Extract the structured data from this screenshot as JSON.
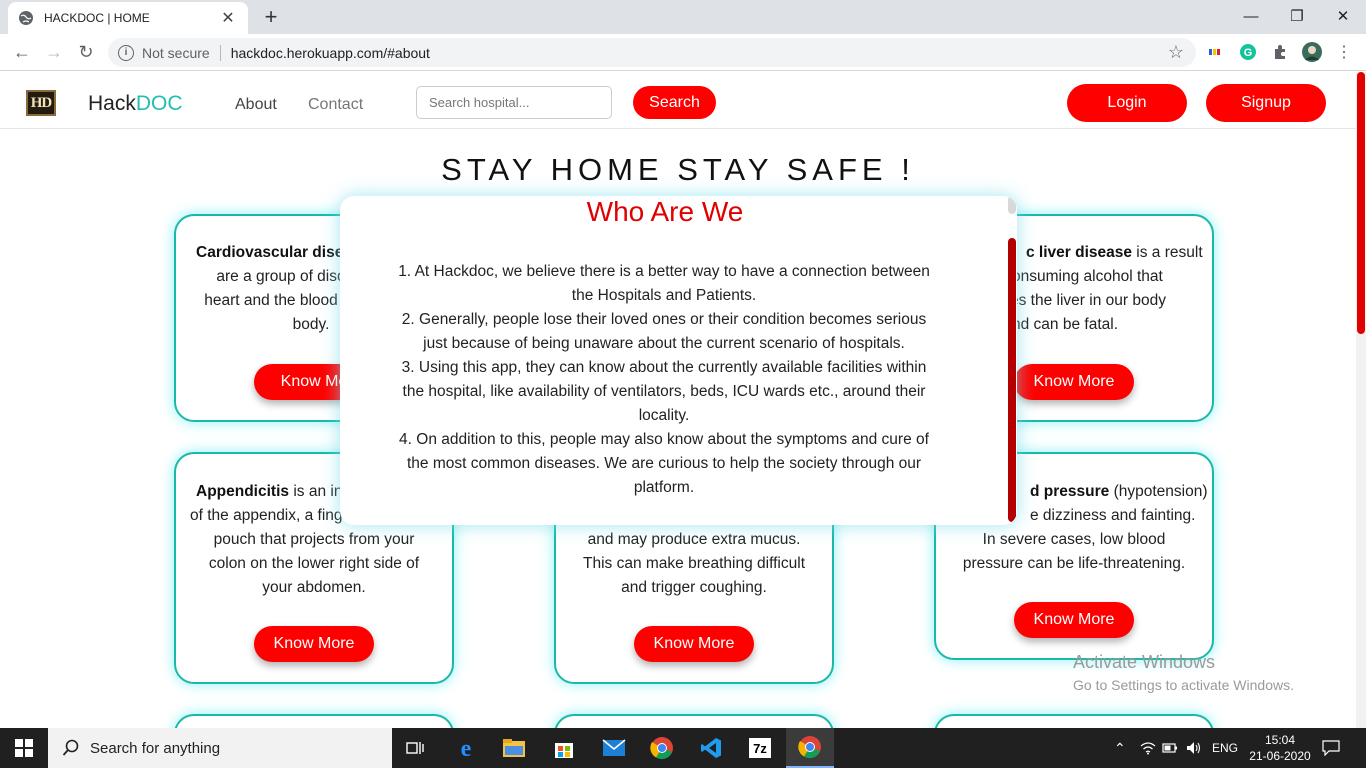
{
  "browser": {
    "tab_title": "HACKDOC | HOME",
    "tab_close": "✕",
    "new_tab": "+",
    "minimize": "—",
    "restore": "❐",
    "close": "✕",
    "back": "←",
    "forward": "→",
    "reload": "↻",
    "security_label": "Not secure",
    "url": "hackdoc.herokuapp.com/#about",
    "bookmark": "☆"
  },
  "nav": {
    "logo_text": "HD",
    "brand_prefix": "Hack",
    "brand_suffix": "DOC",
    "about": "About",
    "contact": "Contact",
    "search_placeholder": "Search hospital...",
    "search_button": "Search",
    "login": "Login",
    "signup": "Signup",
    "about_color": "#444444",
    "contact_color": "#777777"
  },
  "headline": "STAY HOME STAY SAFE !",
  "cards": [
    {
      "bold": "Cardiovascular dise",
      "text_lines": [
        "are a group of diso",
        "heart and the blood",
        "body."
      ],
      "button": "Know Mo"
    },
    {
      "bold": "c liver disease",
      "rest": " is a result",
      "text_lines": [
        "onsuming alcohol that",
        "es the liver in our body",
        "nd can be fatal."
      ],
      "button": "Know More"
    },
    {
      "bold": "Appendicitis",
      "rest": " is an in",
      "text_lines": [
        "of the appendix, a fing",
        "pouch that projects from your",
        "colon on the lower right side of",
        "your abdomen."
      ],
      "button": "Know More"
    },
    {
      "text_lines": [
        "and may produce extra mucus.",
        "This can make breathing difficult",
        "and trigger coughing."
      ],
      "button": "Know More"
    },
    {
      "bold": "d pressure",
      "rest": " (hypotension)",
      "text_lines": [
        "e dizziness and fainting.",
        "In severe cases, low blood",
        "pressure can be life-threatening."
      ],
      "button": "Know More"
    }
  ],
  "modal": {
    "title": "Who Are We",
    "paragraphs": [
      "1. At Hackdoc, we believe there is a better way to have a connection between the Hospitals and Patients.",
      "2. Generally, people lose their loved ones or their condition becomes serious just because of being unaware about the current scenario of hospitals.",
      "3. Using this app, they can know about the currently available facilities within the hospital, like availability of ventilators, beds, ICU wards etc., around their locality.",
      "4. On addition to this, people may also know about the symptoms and cure of the most common diseases. We are curious to help the society through our platform."
    ]
  },
  "watermark": {
    "title": "Activate Windows",
    "subtitle": "Go to Settings to activate Windows."
  },
  "taskbar": {
    "search_text": "Search for anything",
    "lang": "ENG",
    "time": "15:04",
    "date": "21-06-2020",
    "zip_label": "7z"
  },
  "colors": {
    "accent_red": "#ff0000",
    "brand_teal": "#20c0b0",
    "card_border": "#1ab8a8"
  }
}
